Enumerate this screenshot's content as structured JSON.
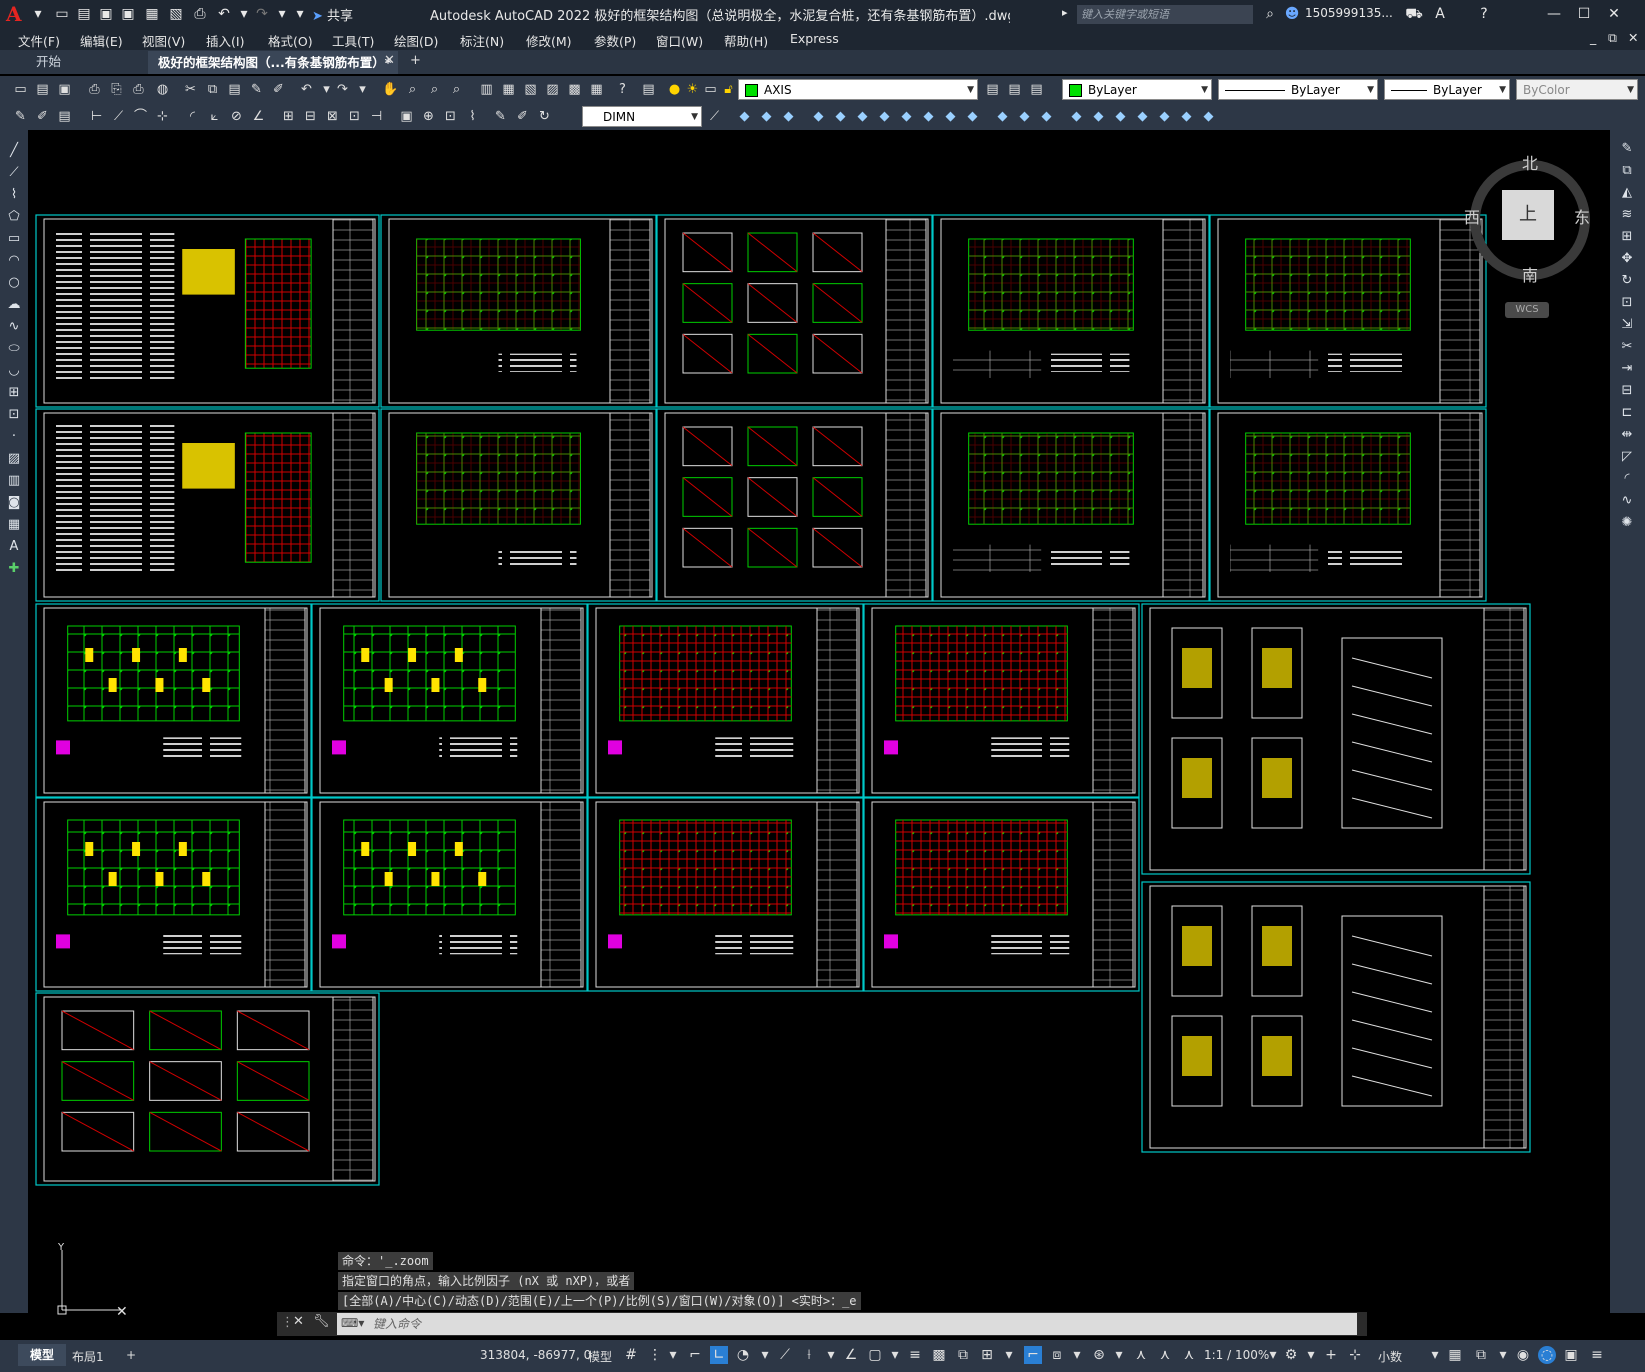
{
  "app": {
    "title": "Autodesk AutoCAD 2022    极好的框架结构图（总说明极全，水泥复合桩，还有条基钢筋布置）.dwg",
    "search_placeholder": "键入关键字或短语",
    "user": "1505999135...",
    "share_label": "共享"
  },
  "menu": [
    "文件(F)",
    "编辑(E)",
    "视图(V)",
    "插入(I)",
    "格式(O)",
    "工具(T)",
    "绘图(D)",
    "标注(N)",
    "修改(M)",
    "参数(P)",
    "窗口(W)",
    "帮助(H)",
    "Express"
  ],
  "tabs": {
    "start": "开始",
    "document": "极好的框架结构图（...有条基钢筋布置）*"
  },
  "toolbar": {
    "layer": "AXIS",
    "color": "ByLayer",
    "linetype": "ByLayer",
    "lineweight": "ByLayer",
    "plotstyle": "ByColor",
    "dimstyle": "DIMN"
  },
  "viewcube": {
    "north": "北",
    "south": "南",
    "east": "东",
    "west": "西",
    "face": "上",
    "wcs": "WCS"
  },
  "command": {
    "history": [
      "命令：'_.zoom",
      "指定窗口的角点，输入比例因子 (nX 或 nXP)，或者",
      "[全部(A)/中心(C)/动态(D)/范围(E)/上一个(P)/比例(S)/窗口(W)/对象(O)] <实时>：_e"
    ],
    "placeholder": "键入命令"
  },
  "status": {
    "model_tab": "模型",
    "layout_tab": "布局1",
    "coords": "313804, -86977, 0",
    "space": "模型",
    "scale": "1:1 / 100%",
    "units": "小数"
  },
  "colors": {
    "accent": "#00c8c8",
    "bg": "#000000",
    "chrome": "#2d3746"
  }
}
